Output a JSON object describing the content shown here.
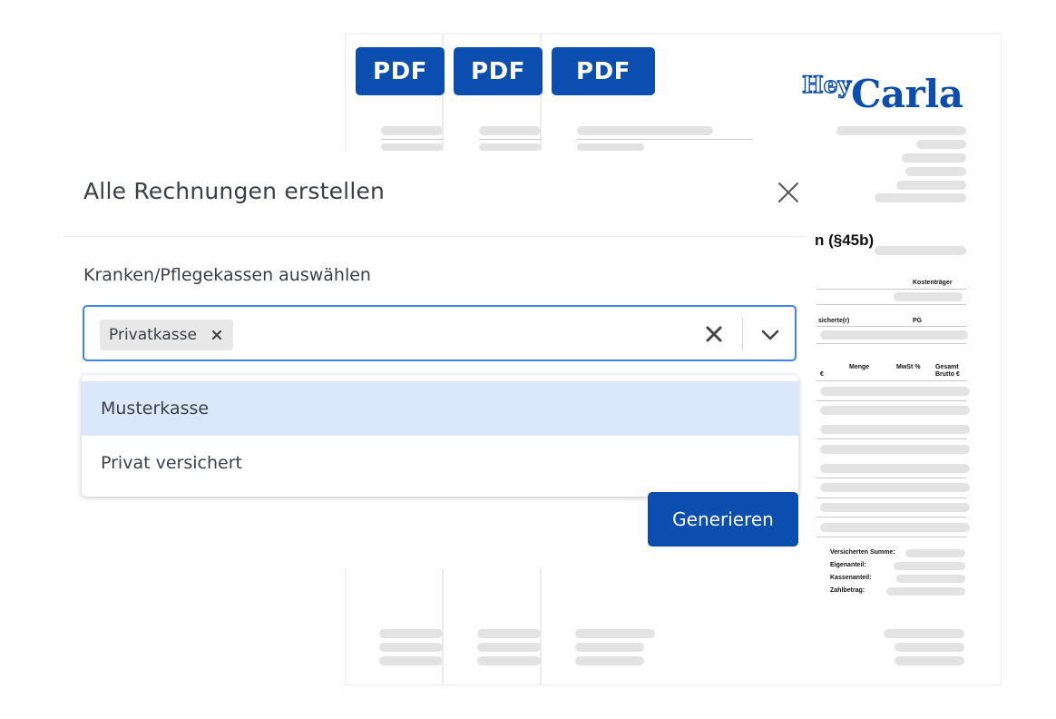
{
  "modal": {
    "title": "Alle Rechnungen erstellen",
    "field_label": "Kranken/Pflegekassen auswählen",
    "selected_chip": "Privatkasse",
    "options": [
      "Musterkasse",
      "Privat versichert"
    ],
    "active_option_index": 0,
    "generate_label": "Generieren"
  },
  "background": {
    "pdf_label": "PDF",
    "logo_small": "Hey",
    "logo_big": "Carla",
    "invoice_heading": "n (§45b)",
    "col_kostentraeger": "Kostenträger",
    "col_versicherte": "sicherte(r)",
    "col_pg": "PG",
    "col_euro": "€",
    "col_menge": "Menge",
    "col_mwst": "MwSt %",
    "col_gesamt": "Gesamt",
    "col_brutto": "Brutto €",
    "sum_versichert": "Versicherten Summe:",
    "sum_eigen": "Eigenanteil:",
    "sum_kasse": "Kassenanteil:",
    "sum_zahl": "Zahlbetrag:"
  },
  "colors": {
    "brand_blue": "#0b4eaf",
    "focus_blue": "#3b86e8",
    "option_highlight": "#dbe7fb"
  },
  "icons": {
    "close": "close-icon",
    "chip_remove": "x-icon",
    "clear": "clear-icon",
    "dropdown": "chevron-down-icon"
  }
}
